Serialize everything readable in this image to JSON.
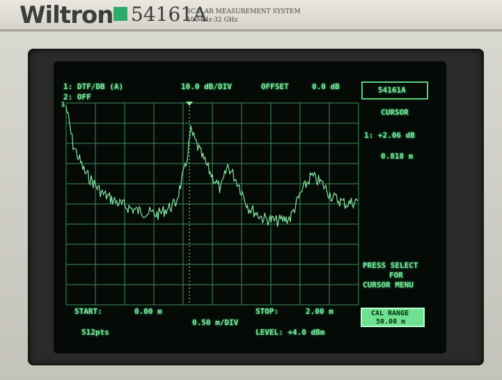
{
  "header": {
    "brand": "Wiltron",
    "model": "54161A",
    "description_line1": "SCALAR MEASUREMENT SYSTEM",
    "description_line2": "10 MHz-32 GHz"
  },
  "status": {
    "channel1": "1: DTF/DB (A)",
    "channel2": "2: OFF",
    "scale": "10.0 dB/DIV",
    "offset_label": "OFFSET",
    "offset_value": "0.0 dB"
  },
  "right_panel": {
    "model_box": "54161A",
    "cursor_title": "CURSOR",
    "cursor_value": "1: +2.06 dB",
    "cursor_distance": "0.818 m",
    "press_select_1": "PRESS SELECT",
    "press_select_2": "FOR",
    "press_select_3": "CURSOR MENU",
    "cal_range_label": "CAL RANGE",
    "cal_range_value": "50.00 m"
  },
  "footer": {
    "start_label": "START:",
    "start_value": "0.00 m",
    "stop_label": "STOP:",
    "stop_value": "2.00 m",
    "scale_x": "0.50 m/DIV",
    "points": "512pts",
    "level": "LEVEL: +4.0 dBm"
  },
  "trace_marker_label": "1",
  "colors": {
    "phosphor": "#7fe8a0",
    "grid": "#3f8f57",
    "screen_bg": "#050a07"
  }
}
